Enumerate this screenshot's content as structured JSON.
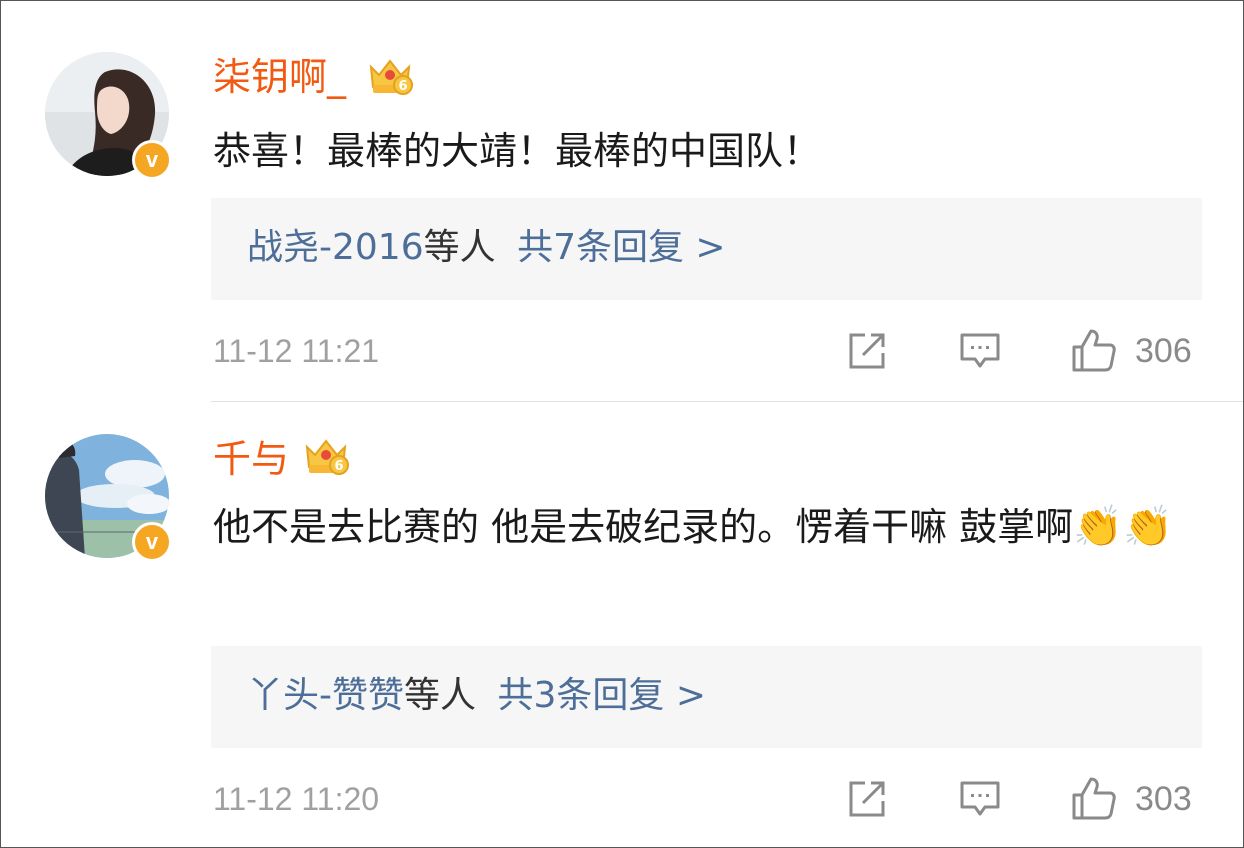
{
  "comments": [
    {
      "username": "柒钥啊_",
      "content": "恭喜！最棒的大靖！最棒的中国队！",
      "emoji": "",
      "replies": {
        "users": "战尧-2016",
        "suffix": "等人",
        "count_text": "共7条回复 >"
      },
      "timestamp": "11-12 11:21",
      "likes": "306",
      "verified_mark": "v",
      "crown_level": "6"
    },
    {
      "username": "千与",
      "content": "他不是去比赛的 他是去破纪录的。愣着干嘛 鼓掌啊",
      "emoji": "👏👏",
      "replies": {
        "users": "丫头-赞赞",
        "suffix": "等人",
        "count_text": "共3条回复 >"
      },
      "timestamp": "11-12 11:20",
      "likes": "303",
      "verified_mark": "v",
      "crown_level": "6"
    }
  ],
  "colors": {
    "username": "#f25a12",
    "link": "#4d6e98",
    "meta": "#a0a0a0",
    "verified": "#f5a623",
    "reply_bg": "#f6f6f6"
  },
  "icons": [
    "share-icon",
    "comment-icon",
    "like-icon",
    "crown-badge-icon",
    "verified-badge-icon"
  ]
}
